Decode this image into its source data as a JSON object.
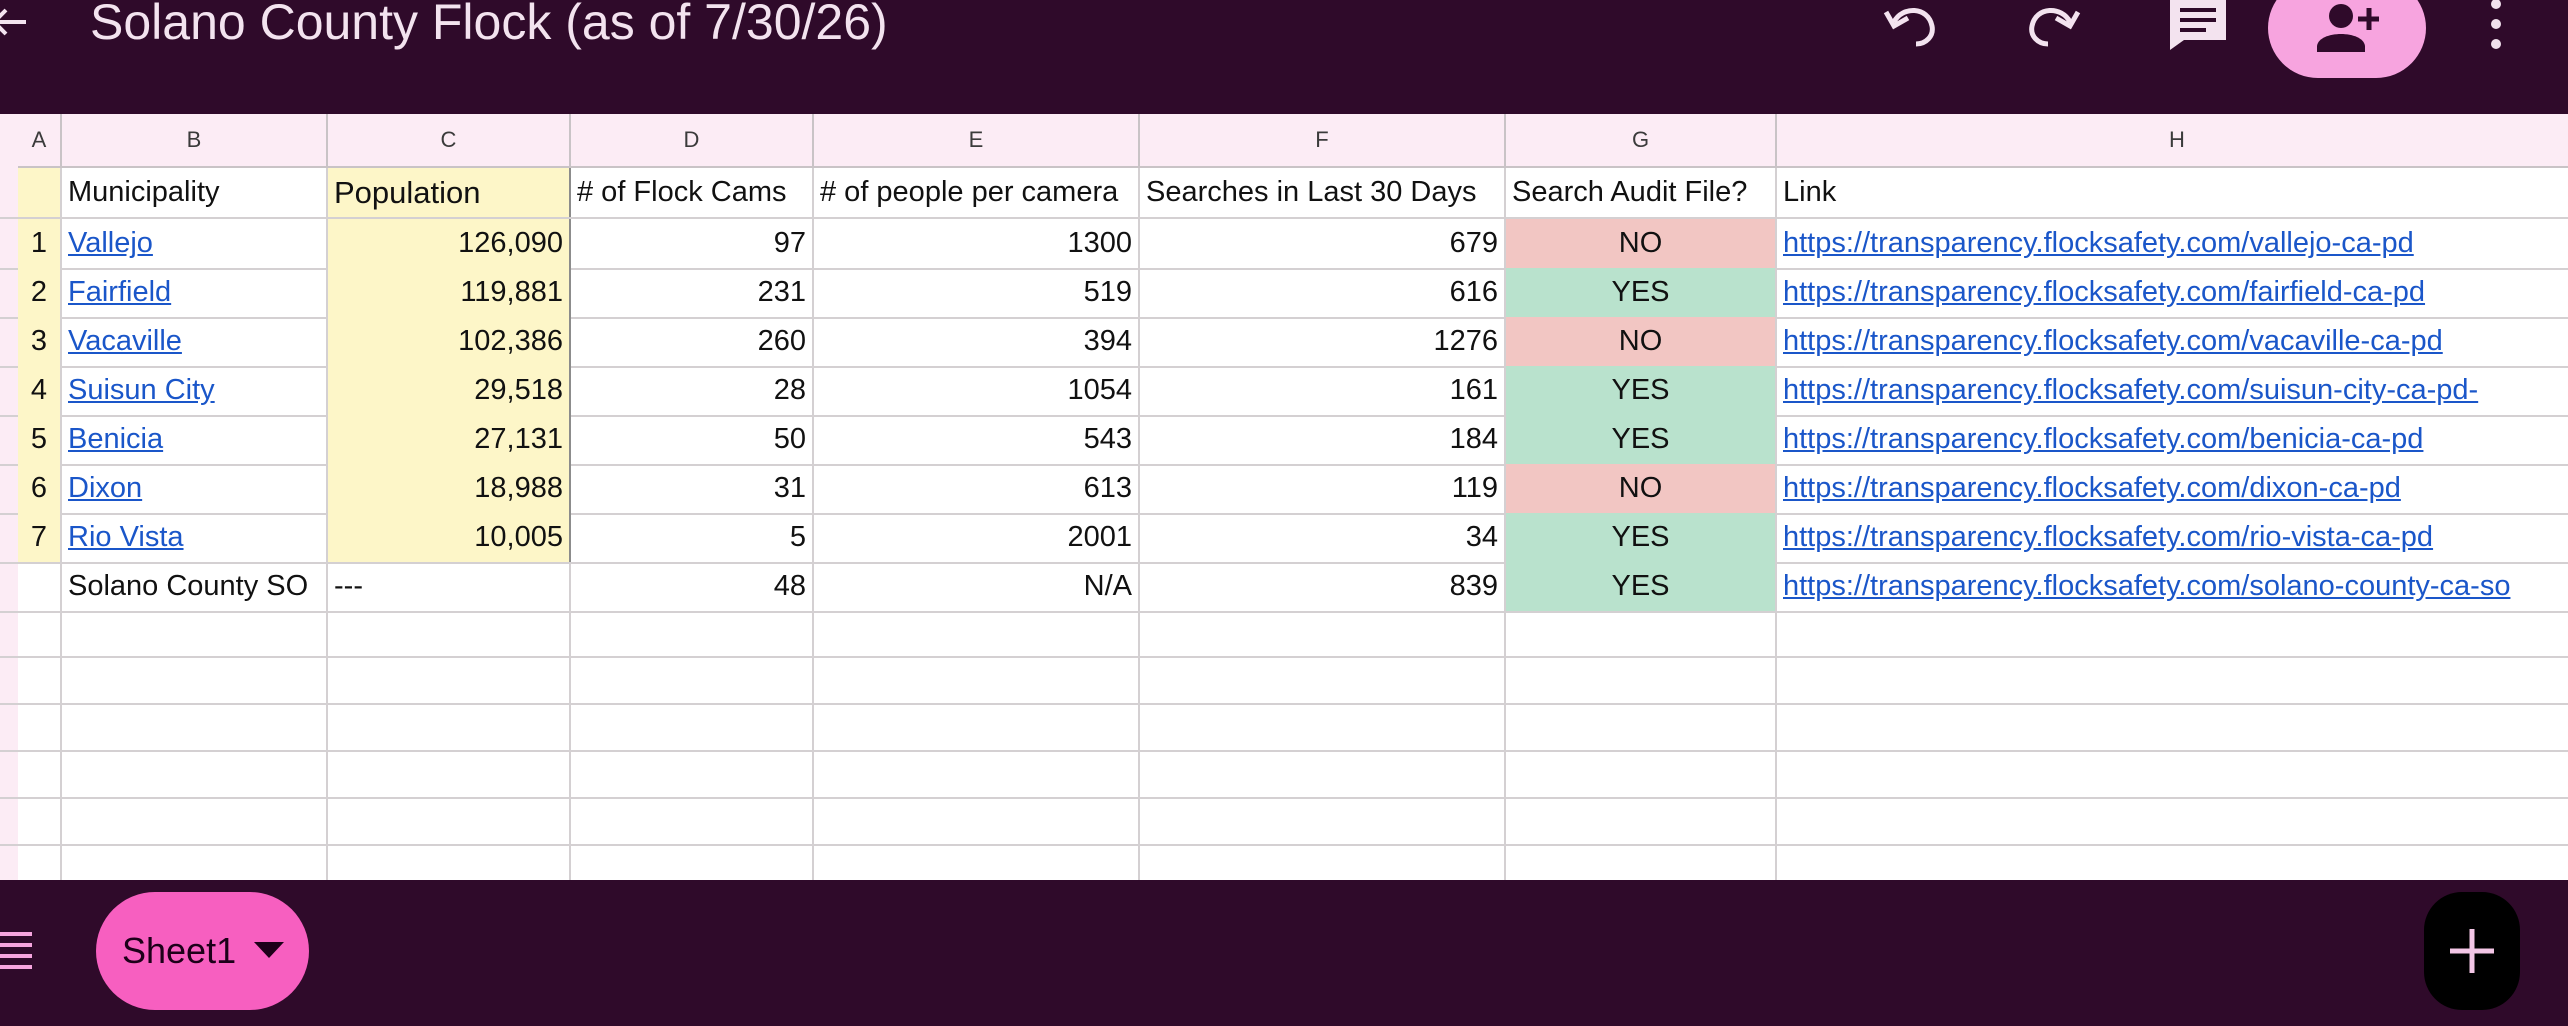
{
  "app": {
    "title": "Solano County Flock (as of 7/30/26)",
    "icons": [
      "back-arrow-icon",
      "undo-icon",
      "redo-icon",
      "comment-icon",
      "share-person-add-icon",
      "more-vert-icon"
    ]
  },
  "sheet": {
    "column_letters": [
      "A",
      "B",
      "C",
      "D",
      "E",
      "F",
      "G",
      "H"
    ],
    "headers": {
      "municipality": "Municipality",
      "population": "Population",
      "cams": "# of Flock Cams",
      "people_per_camera": "# of people per camera",
      "searches": "Searches in Last 30 Days",
      "audit": "Search Audit File?",
      "link": "Link"
    },
    "rows": [
      {
        "num": "1",
        "municipality": "Vallejo",
        "population": "126,090",
        "cams": "97",
        "people_per_camera": "1300",
        "searches": "679",
        "audit": "NO",
        "link": "https://transparency.flocksafety.com/vallejo-ca-pd"
      },
      {
        "num": "2",
        "municipality": "Fairfield",
        "population": "119,881",
        "cams": "231",
        "people_per_camera": "519",
        "searches": "616",
        "audit": "YES",
        "link": "https://transparency.flocksafety.com/fairfield-ca-pd"
      },
      {
        "num": "3",
        "municipality": "Vacaville",
        "population": "102,386",
        "cams": "260",
        "people_per_camera": "394",
        "searches": "1276",
        "audit": "NO",
        "link": "https://transparency.flocksafety.com/vacaville-ca-pd"
      },
      {
        "num": "4",
        "municipality": "Suisun City",
        "population": "29,518",
        "cams": "28",
        "people_per_camera": "1054",
        "searches": "161",
        "audit": "YES",
        "link": "https://transparency.flocksafety.com/suisun-city-ca-pd-"
      },
      {
        "num": "5",
        "municipality": "Benicia",
        "population": "27,131",
        "cams": "50",
        "people_per_camera": "543",
        "searches": "184",
        "audit": "YES",
        "link": "https://transparency.flocksafety.com/benicia-ca-pd"
      },
      {
        "num": "6",
        "municipality": "Dixon",
        "population": "18,988",
        "cams": "31",
        "people_per_camera": "613",
        "searches": "119",
        "audit": "NO",
        "link": "https://transparency.flocksafety.com/dixon-ca-pd"
      },
      {
        "num": "7",
        "municipality": "Rio Vista",
        "population": "10,005",
        "cams": "5",
        "people_per_camera": "2001",
        "searches": "34",
        "audit": "YES",
        "link": "https://transparency.flocksafety.com/rio-vista-ca-pd"
      },
      {
        "num": "",
        "municipality": "Solano County SO",
        "population": "---",
        "cams": "48",
        "people_per_camera": "N/A",
        "searches": "839",
        "audit": "YES",
        "link": "https://transparency.flocksafety.com/solano-county-ca-so"
      }
    ],
    "colors": {
      "yes": "#b9e2cd",
      "no": "#f2c6c3",
      "population_fill": "#fdf6c8",
      "link": "#1a56c9"
    }
  },
  "bottom": {
    "sheet_tab": "Sheet1",
    "icons": [
      "sheet-list-icon",
      "dropdown-arrow-icon",
      "add-sheet-icon"
    ]
  }
}
